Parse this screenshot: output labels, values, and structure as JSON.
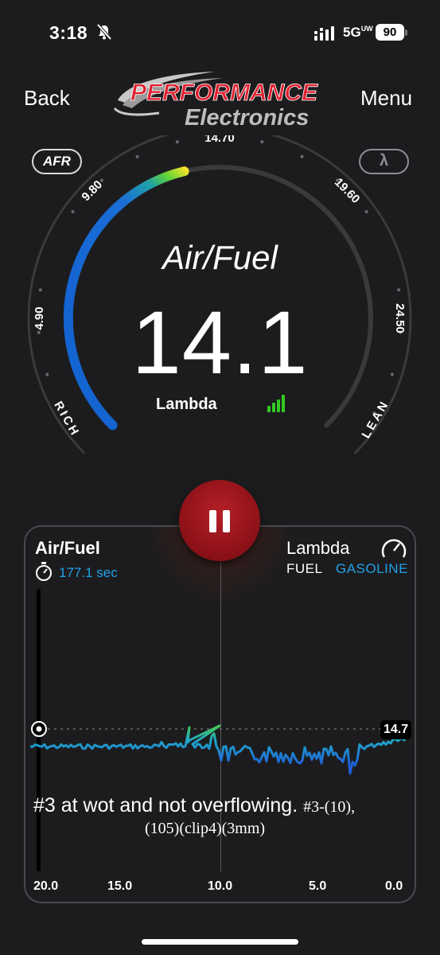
{
  "status": {
    "time": "3:18",
    "network": "5G",
    "network_sub": "UW",
    "battery": "90"
  },
  "header": {
    "back_label": "Back",
    "menu_label": "Menu",
    "logo_line1": "PERFORMANCE",
    "logo_line2": "Electronics"
  },
  "gauge": {
    "mode_afr": "AFR",
    "mode_lambda": "λ",
    "ticks": [
      "4.90",
      "9.80",
      "14.70",
      "19.60",
      "24.50"
    ],
    "rich_label": "RICH",
    "lean_label": "LEAN",
    "title": "Air/Fuel",
    "value": "14.1",
    "sub_label": "Lambda",
    "arc_fraction": 0.45
  },
  "panel": {
    "left_title": "Air/Fuel",
    "timer": "177.1 sec",
    "right_title": "Lambda",
    "fuel_label": "FUEL",
    "fuel_value": "GASOLINE",
    "current_badge": "14.7",
    "x_ticks": [
      "20.0",
      "15.0",
      "10.0",
      "5.0",
      "0.0"
    ],
    "note_line1_main": "#3 at wot and not overflowing.",
    "note_line1_tail": "#3-(10),",
    "note_line2": "(105)(clip4)(3mm)"
  },
  "colors": {
    "accent_blue": "#22a2e8",
    "pause_red": "#a0151c",
    "signal_green": "#34c924"
  }
}
